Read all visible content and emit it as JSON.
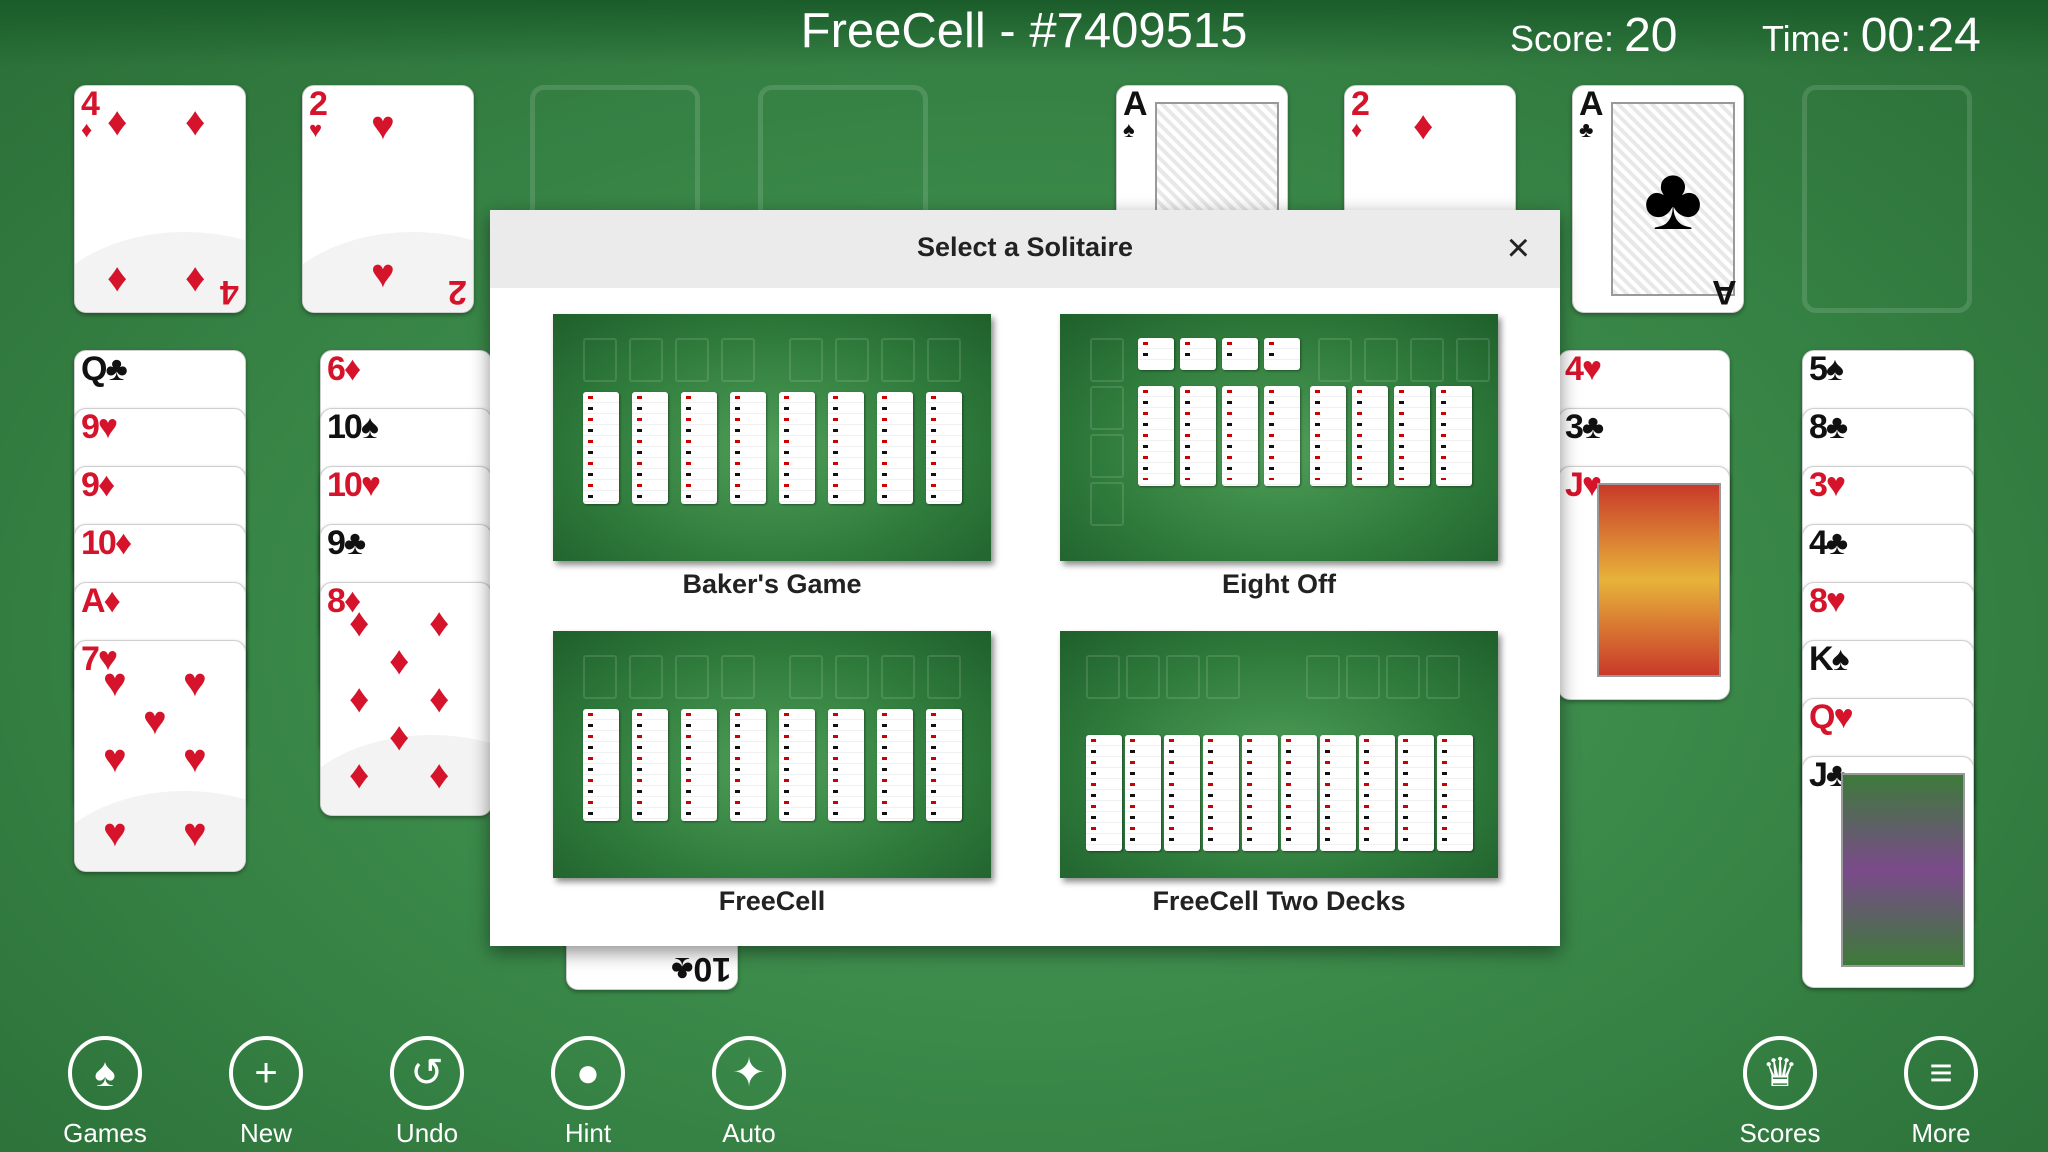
{
  "header": {
    "title": "FreeCell - #7409515",
    "score_label": "Score:",
    "score_value": "20",
    "time_label": "Time:",
    "time_value": "00:24"
  },
  "colors": {
    "felt": "#3b8a4a",
    "red_suit": "#d5142b",
    "black_suit": "#111111"
  },
  "freecells": [
    {
      "rank": "4",
      "suit": "♦"
    },
    {
      "rank": "2",
      "suit": "♥"
    },
    {
      "rank": "",
      "suit": ""
    },
    {
      "rank": "",
      "suit": ""
    }
  ],
  "foundations": [
    {
      "rank": "A",
      "suit": "♠"
    },
    {
      "rank": "2",
      "suit": "♦"
    },
    {
      "rank": "A",
      "suit": "♣"
    },
    {
      "rank": "",
      "suit": ""
    }
  ],
  "tableau": {
    "col1": [
      "Q♣",
      "9♥",
      "9♦",
      "10♦",
      "A♦",
      "7♥"
    ],
    "col2": [
      "6♦",
      "10♠",
      "10♥",
      "9♣",
      "8♦"
    ],
    "col3_visible": [
      "10♣"
    ],
    "col7": [
      "4♥",
      "3♣",
      "J♥"
    ],
    "col8": [
      "5♠",
      "8♣",
      "3♥",
      "4♣",
      "8♥",
      "K♠",
      "Q♥",
      "J♣"
    ]
  },
  "dialog": {
    "title": "Select a Solitaire",
    "close_icon": "×",
    "games": [
      {
        "label": "Baker's Game"
      },
      {
        "label": "Eight Off"
      },
      {
        "label": "FreeCell"
      },
      {
        "label": "FreeCell Two Decks"
      }
    ]
  },
  "toolbar": {
    "games": "Games",
    "new": "New",
    "undo": "Undo",
    "hint": "Hint",
    "auto": "Auto",
    "scores": "Scores",
    "more": "More"
  }
}
